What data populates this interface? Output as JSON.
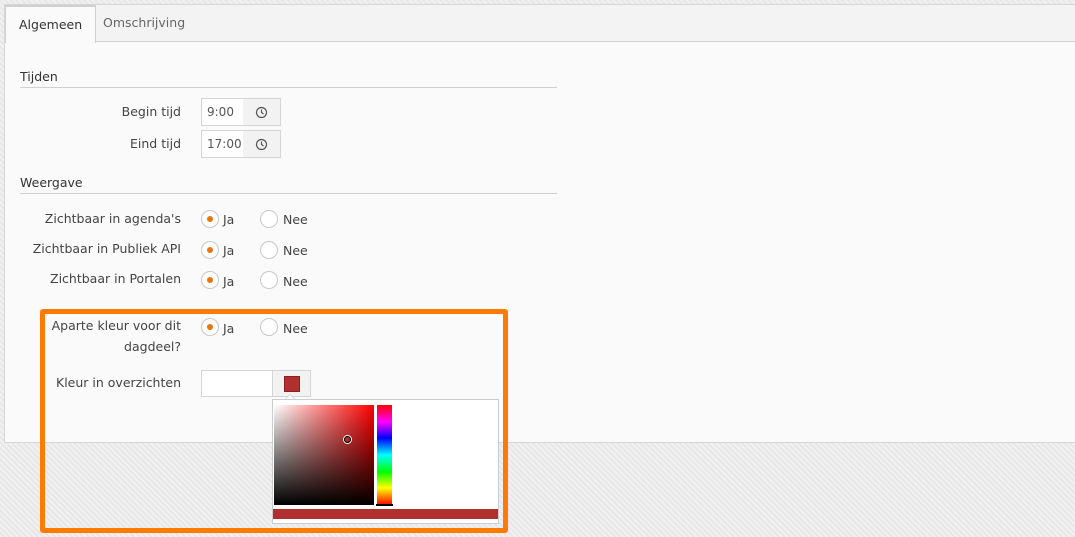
{
  "tabs": [
    {
      "label": "Algemeen",
      "active": true
    },
    {
      "label": "Omschrijving",
      "active": false
    }
  ],
  "sections": {
    "tijden": {
      "title": "Tijden",
      "begin_label": "Begin tijd",
      "begin_value": "9:00",
      "end_label": "Eind tijd",
      "end_value": "17:00"
    },
    "weergave": {
      "title": "Weergave",
      "rows": [
        {
          "label": "Zichtbaar in agenda's",
          "yes": "Ja",
          "no": "Nee",
          "selected": "Ja"
        },
        {
          "label": "Zichtbaar in Publiek API",
          "yes": "Ja",
          "no": "Nee",
          "selected": "Ja"
        },
        {
          "label": "Zichtbaar in Portalen",
          "yes": "Ja",
          "no": "Nee",
          "selected": "Ja"
        }
      ]
    }
  },
  "color_section": {
    "aparte_label_line1": "Aparte kleur voor dit",
    "aparte_label_line2": "dagdeel?",
    "aparte_yes": "Ja",
    "aparte_no": "Nee",
    "aparte_selected": "Ja",
    "kleur_label": "Kleur in overzichten",
    "kleur_value": "",
    "swatch_color": "#b03030",
    "highlight_color": "#ff7a00",
    "accent_color": "#e87511"
  },
  "icons": {
    "clock": "clock-icon",
    "swatch": "color-swatch-icon"
  }
}
